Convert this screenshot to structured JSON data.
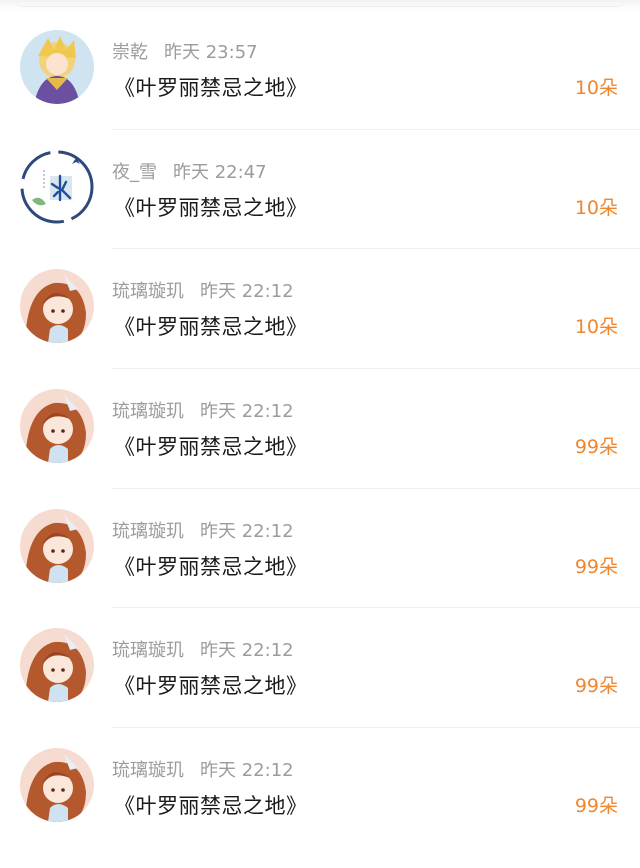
{
  "colors": {
    "gift_text": "#f0862e",
    "meta_text": "#9c9c9c",
    "title_text": "#1a1a1a",
    "divider": "#f0f0f0"
  },
  "rows": [
    {
      "name": "崇乾",
      "time": "昨天 23:57",
      "title": "《叶罗丽禁忌之地》",
      "gift": "10朵",
      "avatar": "anime-boy-avatar"
    },
    {
      "name": "夜_雪",
      "time": "昨天 22:47",
      "title": "《叶罗丽禁忌之地》",
      "gift": "10朵",
      "avatar": "calligraphy-bing-avatar"
    },
    {
      "name": "琉璃璇玑",
      "time": "昨天 22:12",
      "title": "《叶罗丽禁忌之地》",
      "gift": "10朵",
      "avatar": "anime-girl-avatar"
    },
    {
      "name": "琉璃璇玑",
      "time": "昨天 22:12",
      "title": "《叶罗丽禁忌之地》",
      "gift": "99朵",
      "avatar": "anime-girl-avatar"
    },
    {
      "name": "琉璃璇玑",
      "time": "昨天 22:12",
      "title": "《叶罗丽禁忌之地》",
      "gift": "99朵",
      "avatar": "anime-girl-avatar"
    },
    {
      "name": "琉璃璇玑",
      "time": "昨天 22:12",
      "title": "《叶罗丽禁忌之地》",
      "gift": "99朵",
      "avatar": "anime-girl-avatar"
    },
    {
      "name": "琉璃璇玑",
      "time": "昨天 22:12",
      "title": "《叶罗丽禁忌之地》",
      "gift": "99朵",
      "avatar": "anime-girl-avatar"
    }
  ]
}
